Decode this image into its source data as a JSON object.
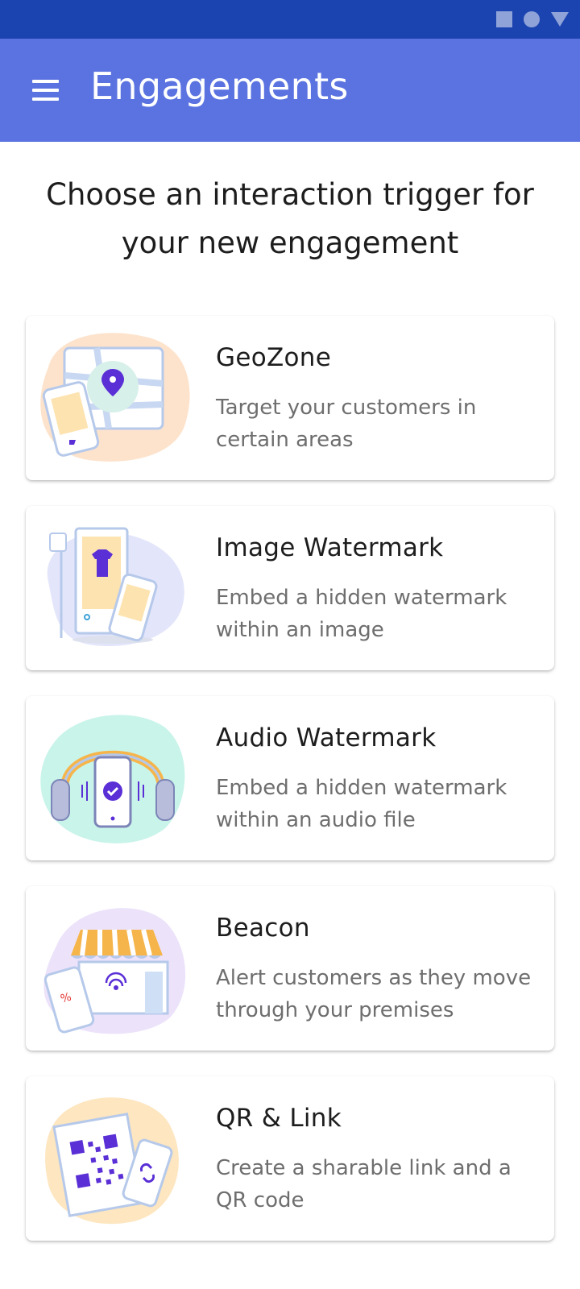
{
  "status_bar": {
    "icons": [
      "square-icon",
      "circle-icon",
      "triangle-icon"
    ]
  },
  "app_bar": {
    "title": "Engagements",
    "menu_icon": "hamburger-menu-icon"
  },
  "headline": "Choose an interaction trigger for your new engagement",
  "cards": [
    {
      "title": "GeoZone",
      "description": "Target your customers in certain areas",
      "icon": "geozone-illustration"
    },
    {
      "title": "Image Watermark",
      "description": "Embed a hidden watermark within an image",
      "icon": "image-watermark-illustration"
    },
    {
      "title": "Audio Watermark",
      "description": "Embed a hidden watermark within an audio file",
      "icon": "audio-watermark-illustration"
    },
    {
      "title": "Beacon",
      "description": "Alert customers as they move through your premises",
      "icon": "beacon-illustration"
    },
    {
      "title": "QR & Link",
      "description": "Create a sharable link and a QR code",
      "icon": "qr-link-illustration"
    }
  ],
  "colors": {
    "status_bar": "#1b44b0",
    "app_bar": "#5b73e0",
    "accent_purple": "#5a2fd6",
    "description_text": "#6e6e6e"
  }
}
